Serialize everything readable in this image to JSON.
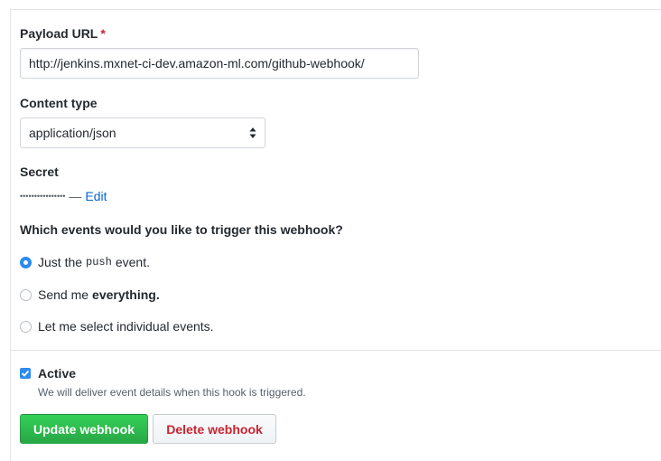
{
  "payload_url": {
    "label": "Payload URL",
    "required_mark": "*",
    "value": "http://jenkins.mxnet-ci-dev.amazon-ml.com/github-webhook/"
  },
  "content_type": {
    "label": "Content type",
    "selected": "application/json"
  },
  "secret": {
    "label": "Secret",
    "masked_value": "••••••••••••••••",
    "separator": "—",
    "edit_label": "Edit"
  },
  "events": {
    "question": "Which events would you like to trigger this webhook?",
    "options": [
      {
        "pre": "Just the",
        "code": "push",
        "post": "event.",
        "checked": true
      },
      {
        "pre": "Send me",
        "bold": "everything.",
        "checked": false
      },
      {
        "pre": "Let me select individual events.",
        "checked": false
      }
    ]
  },
  "active": {
    "label": "Active",
    "checked": true,
    "description": "We will deliver event details when this hook is triggered."
  },
  "actions": {
    "update_label": "Update webhook",
    "delete_label": "Delete webhook"
  },
  "colors": {
    "accent_blue": "#2b8bf0",
    "link_blue": "#0366d6",
    "required_red": "#cb2431",
    "primary_green": "#28a745"
  }
}
